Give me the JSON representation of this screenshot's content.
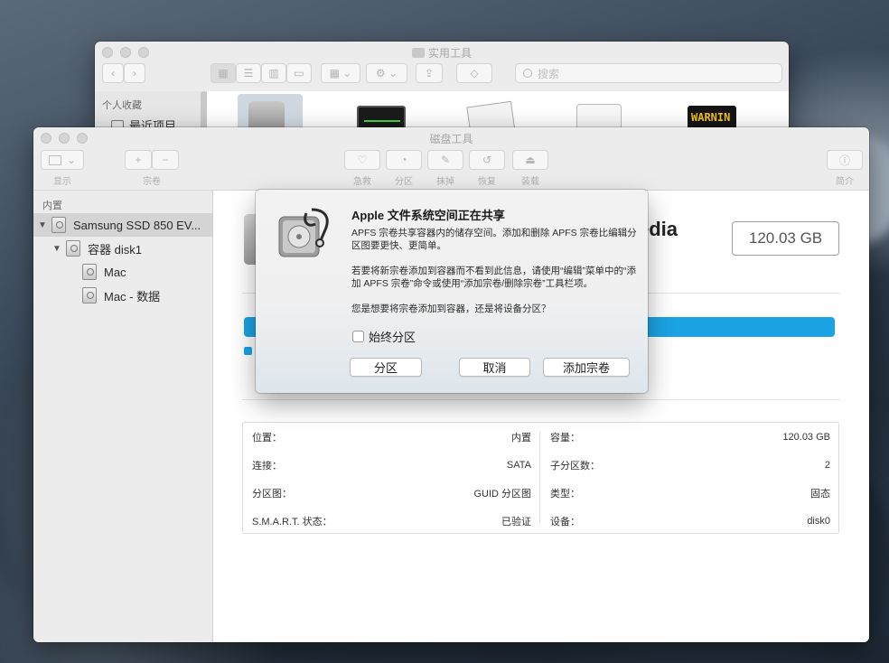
{
  "finder": {
    "title": "实用工具",
    "search_placeholder": "搜索",
    "sidebar_heading": "个人收藏",
    "sidebar_item": "最近项目",
    "warning_app_text": "WARNIN"
  },
  "disk_utility": {
    "title": "磁盘工具",
    "toolbar": {
      "view_label": "显示",
      "volume_label": "宗卷",
      "first_aid_label": "急救",
      "partition_label": "分区",
      "erase_label": "抹掉",
      "restore_label": "恢复",
      "mount_label": "装载",
      "info_label": "简介",
      "add_symbol": "+",
      "remove_symbol": "−"
    },
    "sidebar": {
      "heading": "内置",
      "items": [
        {
          "label": "Samsung SSD 850 EV..."
        },
        {
          "label": "容器 disk1"
        },
        {
          "label": "Mac"
        },
        {
          "label": "Mac - 数据"
        }
      ]
    },
    "main": {
      "name_fragment": "edia",
      "capacity": "120.03 GB"
    },
    "info": {
      "left": [
        {
          "key": "位置：",
          "value": "内置"
        },
        {
          "key": "连接：",
          "value": "SATA"
        },
        {
          "key": "分区图：",
          "value": "GUID 分区图"
        },
        {
          "key": "S.M.A.R.T. 状态：",
          "value": "已验证"
        }
      ],
      "right": [
        {
          "key": "容量：",
          "value": "120.03 GB"
        },
        {
          "key": "子分区数：",
          "value": "2"
        },
        {
          "key": "类型：",
          "value": "固态"
        },
        {
          "key": "设备：",
          "value": "disk0"
        }
      ]
    }
  },
  "dialog": {
    "title": "Apple 文件系统空间正在共享",
    "para1": "APFS 宗卷共享容器内的储存空间。添加和删除 APFS 宗卷比编辑分区图要更快、更简单。",
    "para2": "若要将新宗卷添加到容器而不看到此信息，请使用“编辑”菜单中的“添加 APFS 宗卷”命令或使用“添加宗卷/删除宗卷”工具栏项。",
    "para3": "您是想要将宗卷添加到容器，还是将设备分区？",
    "checkbox_label": "始终分区",
    "partition_button": "分区",
    "cancel_button": "取消",
    "add_volume_button": "添加宗卷"
  },
  "colors": {
    "accent": "#1ca3e4"
  }
}
